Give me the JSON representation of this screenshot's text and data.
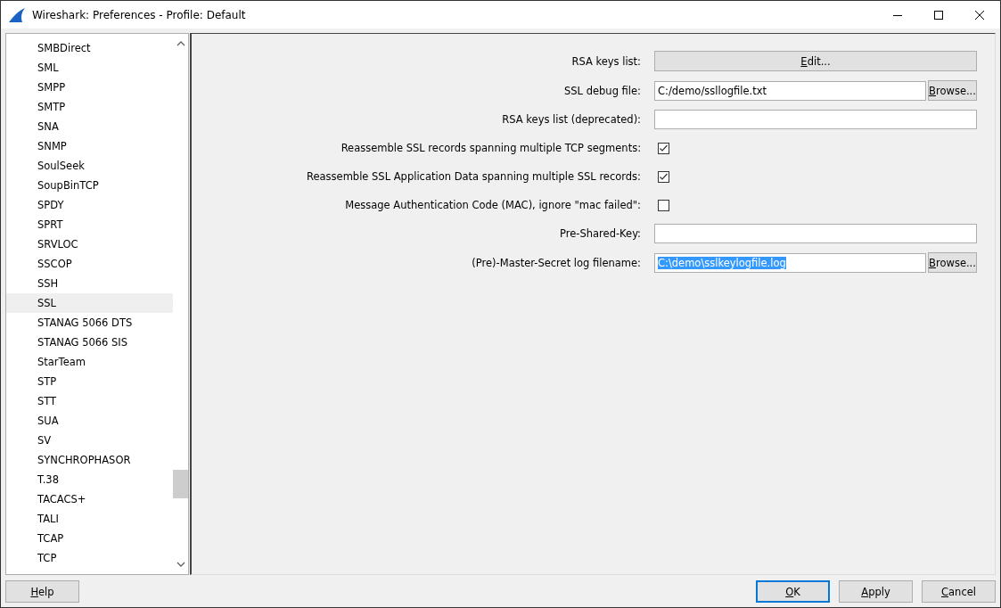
{
  "window": {
    "title": "Wireshark: Preferences - Profile: Default"
  },
  "protocols": [
    {
      "label": "SMBDirect",
      "selected": false
    },
    {
      "label": "SML",
      "selected": false
    },
    {
      "label": "SMPP",
      "selected": false
    },
    {
      "label": "SMTP",
      "selected": false
    },
    {
      "label": "SNA",
      "selected": false
    },
    {
      "label": "SNMP",
      "selected": false
    },
    {
      "label": "SoulSeek",
      "selected": false
    },
    {
      "label": "SoupBinTCP",
      "selected": false
    },
    {
      "label": "SPDY",
      "selected": false
    },
    {
      "label": "SPRT",
      "selected": false
    },
    {
      "label": "SRVLOC",
      "selected": false
    },
    {
      "label": "SSCOP",
      "selected": false
    },
    {
      "label": "SSH",
      "selected": false
    },
    {
      "label": "SSL",
      "selected": true
    },
    {
      "label": "STANAG 5066 DTS",
      "selected": false
    },
    {
      "label": "STANAG 5066 SIS",
      "selected": false
    },
    {
      "label": "StarTeam",
      "selected": false
    },
    {
      "label": "STP",
      "selected": false
    },
    {
      "label": "STT",
      "selected": false
    },
    {
      "label": "SUA",
      "selected": false
    },
    {
      "label": "SV",
      "selected": false
    },
    {
      "label": "SYNCHROPHASOR",
      "selected": false
    },
    {
      "label": "T.38",
      "selected": false
    },
    {
      "label": "TACACS+",
      "selected": false
    },
    {
      "label": "TALI",
      "selected": false
    },
    {
      "label": "TCAP",
      "selected": false
    },
    {
      "label": "TCP",
      "selected": false
    }
  ],
  "settings": [
    {
      "kind": "button",
      "label": "RSA keys list:",
      "button": "Edit..."
    },
    {
      "kind": "file",
      "label": "SSL debug file:",
      "value": "C:/demo/ssllogfile.txt",
      "highlighted": false,
      "button": "Browse..."
    },
    {
      "kind": "text",
      "label": "RSA keys list (deprecated):"
    },
    {
      "kind": "checkbox",
      "label": "Reassemble SSL records spanning multiple TCP segments:",
      "checked": true
    },
    {
      "kind": "checkbox",
      "label": "Reassemble SSL Application Data spanning multiple SSL records:",
      "checked": true
    },
    {
      "kind": "checkbox",
      "label": "Message Authentication Code (MAC), ignore \"mac failed\":",
      "checked": false
    },
    {
      "kind": "text",
      "label": "Pre-Shared-Key:"
    },
    {
      "kind": "file",
      "label": "(Pre)-Master-Secret log filename:",
      "value": "C:\\demo\\sslkeylogfile.log",
      "highlighted": true,
      "button": "Browse..."
    }
  ],
  "buttons": {
    "left": [
      {
        "label": "Help",
        "default": false
      }
    ],
    "right": [
      {
        "label": "OK",
        "default": true
      },
      {
        "label": "Apply",
        "default": false
      },
      {
        "label": "Cancel",
        "default": false
      }
    ]
  }
}
